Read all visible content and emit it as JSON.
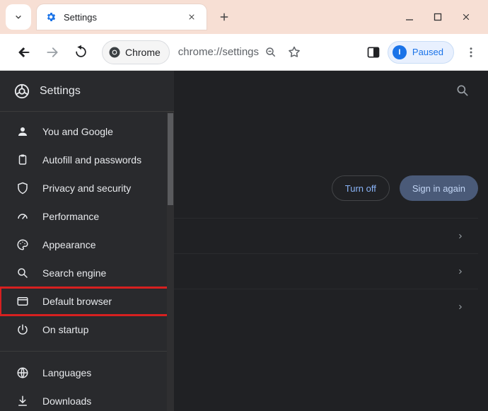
{
  "window": {
    "tab_title": "Settings",
    "url": "chrome://settings",
    "chip_label": "Chrome",
    "profile_status": "Paused",
    "profile_initial": "I"
  },
  "sidebar": {
    "header": "Settings",
    "items": [
      {
        "label": "You and Google"
      },
      {
        "label": "Autofill and passwords"
      },
      {
        "label": "Privacy and security"
      },
      {
        "label": "Performance"
      },
      {
        "label": "Appearance"
      },
      {
        "label": "Search engine"
      },
      {
        "label": "Default browser"
      },
      {
        "label": "On startup"
      }
    ],
    "items2": [
      {
        "label": "Languages"
      },
      {
        "label": "Downloads"
      }
    ]
  },
  "main": {
    "turn_off": "Turn off",
    "sign_in_again": "Sign in again"
  }
}
